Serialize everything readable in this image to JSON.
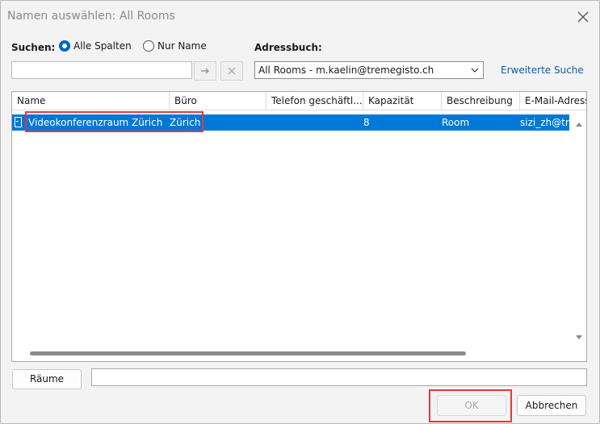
{
  "window": {
    "title": "Namen auswählen: All Rooms"
  },
  "search": {
    "label": "Suchen:",
    "option_all": "Alle Spalten",
    "option_name": "Nur Name",
    "value": ""
  },
  "addressbook": {
    "label": "Adressbuch:",
    "selected": "All Rooms - m.kaelin@tremegisto.ch",
    "advanced_link": "Erweiterte Suche"
  },
  "table": {
    "columns": [
      "Name",
      "Büro",
      "Telefon geschäftl...",
      "Kapazität",
      "Beschreibung",
      "E-Mail-Adresse"
    ],
    "rows": [
      {
        "name": "Videokonferenzraum Zürich",
        "office": "Zürich",
        "phone": "",
        "capacity": "8",
        "description": "Room",
        "email": "sizi_zh@tremegisto.ch"
      }
    ]
  },
  "footer": {
    "rooms_button": "Räume",
    "rooms_value": "",
    "ok_button": "OK",
    "cancel_button": "Abbrechen"
  },
  "colors": {
    "selection": "#0078d7",
    "highlight": "#e0393e",
    "link": "#0b5cad"
  }
}
